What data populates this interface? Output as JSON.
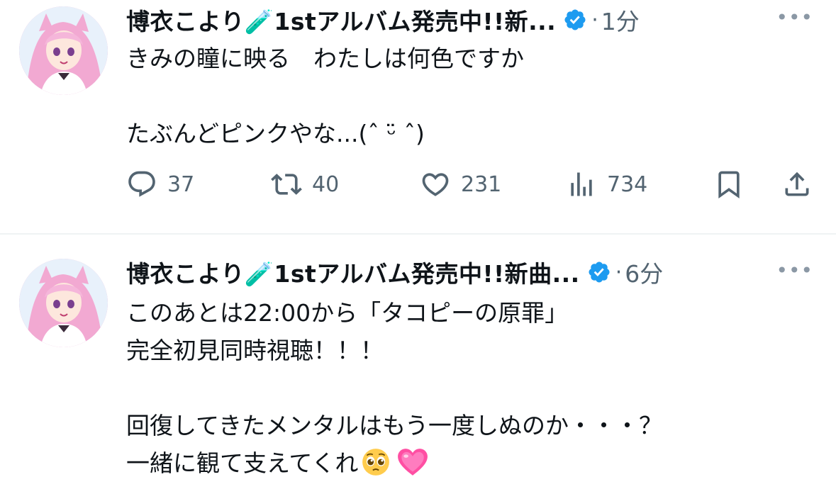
{
  "tweets": [
    {
      "author": "博衣こより🧪1stアルバム発売中!!新...",
      "separator": "·",
      "time": "1分",
      "more_label": "•••",
      "body": "きみの瞳に映る　わたしは何色ですか\n\nたぶんどピンクやな...(ˆ ᵕ̈ ˆ)",
      "stats": {
        "replies": "37",
        "reposts": "40",
        "likes": "231",
        "views": "734"
      }
    },
    {
      "author": "博衣こより🧪1stアルバム発売中!!新曲...",
      "separator": "·",
      "time": "6分",
      "more_label": "•••",
      "body": "このあとは22:00から「タコピーの原罪」\n完全初見同時視聴！！！\n\n回復してきたメンタルはもう一度しぬのか・・・？\n一緒に観て支えてくれ"
    }
  ],
  "colors": {
    "text": "#0f1419",
    "muted": "#536471",
    "verified": "#1d9bf0",
    "divider": "#eff3f4",
    "heart_emoji": "#ff4fa3"
  },
  "icons": [
    "verified-badge-icon",
    "reply-icon",
    "repost-icon",
    "like-icon",
    "views-icon",
    "bookmark-icon",
    "share-icon",
    "more-icon",
    "pleading-face-emoji",
    "pink-heart-emoji"
  ]
}
